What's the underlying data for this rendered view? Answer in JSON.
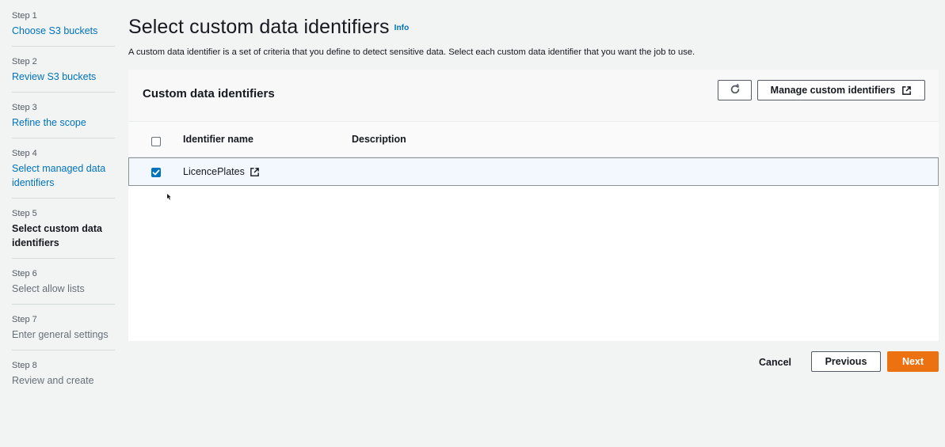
{
  "steps": [
    {
      "num": "Step 1",
      "label": "Choose S3 buckets"
    },
    {
      "num": "Step 2",
      "label": "Review S3 buckets"
    },
    {
      "num": "Step 3",
      "label": "Refine the scope"
    },
    {
      "num": "Step 4",
      "label": "Select managed data identifiers"
    },
    {
      "num": "Step 5",
      "label": "Select custom data identifiers"
    },
    {
      "num": "Step 6",
      "label": "Select allow lists"
    },
    {
      "num": "Step 7",
      "label": "Enter general settings"
    },
    {
      "num": "Step 8",
      "label": "Review and create"
    }
  ],
  "header": {
    "title": "Select custom data identifiers",
    "info": "Info",
    "description": "A custom data identifier is a set of criteria that you define to detect sensitive data. Select each custom data identifier that you want the job to use."
  },
  "container": {
    "title": "Custom data identifiers",
    "manage_label": "Manage custom identifiers",
    "columns": {
      "name": "Identifier name",
      "description": "Description"
    },
    "rows": [
      {
        "name": "LicencePlates",
        "description": "",
        "selected": true
      }
    ]
  },
  "actions": {
    "cancel": "Cancel",
    "previous": "Previous",
    "next": "Next"
  },
  "colors": {
    "link": "#0073bb",
    "primary": "#ec7211",
    "background": "#f2f3f3"
  }
}
